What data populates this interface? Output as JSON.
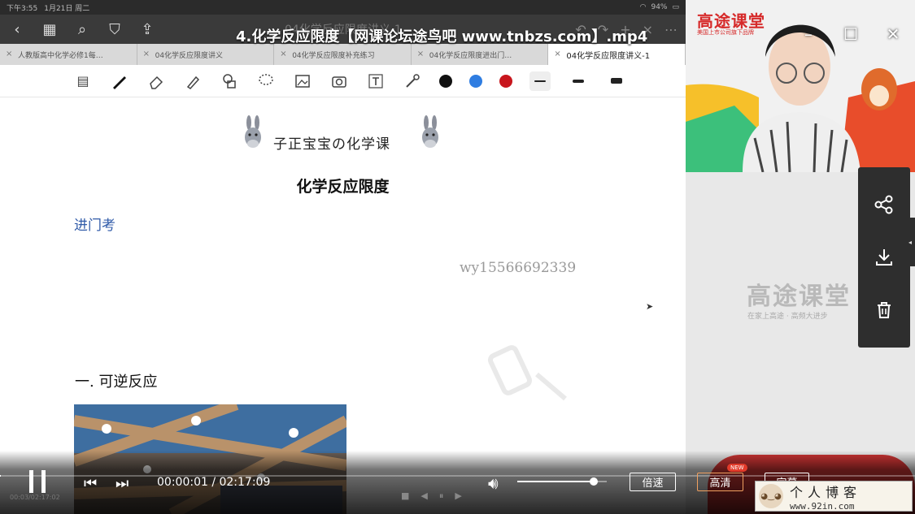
{
  "status_bar": {
    "time": "下午3:55",
    "date": "1月21日 周二",
    "battery": "94%"
  },
  "player": {
    "title": "4.化学反应限度【网课论坛途鸟吧 www.tnbzs.com】.mp4"
  },
  "app": {
    "faint_title": "04化学反应限度讲义-1",
    "tabs": [
      {
        "label": "人教版高中化学必修1每…",
        "active": false
      },
      {
        "label": "04化学反应限度讲义",
        "active": false
      },
      {
        "label": "04化学反应限度补充练习",
        "active": false
      },
      {
        "label": "04化学反应限度进出门…",
        "active": false
      },
      {
        "label": "04化学反应限度讲义-1",
        "active": true
      }
    ],
    "colors": {
      "black": "#111111",
      "blue": "#2f7de1",
      "red": "#c8161d"
    }
  },
  "document": {
    "banner": "子正宝宝の化学课",
    "title": "化学反应限度",
    "section_entry": "进门考",
    "watermark": "wy15566692339",
    "section_1": "一. 可逆反应"
  },
  "right_panel": {
    "brand": "高途课堂",
    "brand_sub": "美国上市公司旗下品牌",
    "logo": "高途课堂",
    "logo_sub": "在家上高途 · 高频大进步"
  },
  "controls": {
    "time_display": "00:00:01 / 02:17:09",
    "progress_fraction": 0.0001,
    "volume_fraction": 0.85,
    "speed_label": "倍速",
    "quality_label": "高清",
    "new_badge": "NEW",
    "subtitle_label": "字幕",
    "mini_time": "00:03/02:17:02"
  },
  "site_badge": {
    "name": "个人博客",
    "url": "www.92in.com"
  }
}
